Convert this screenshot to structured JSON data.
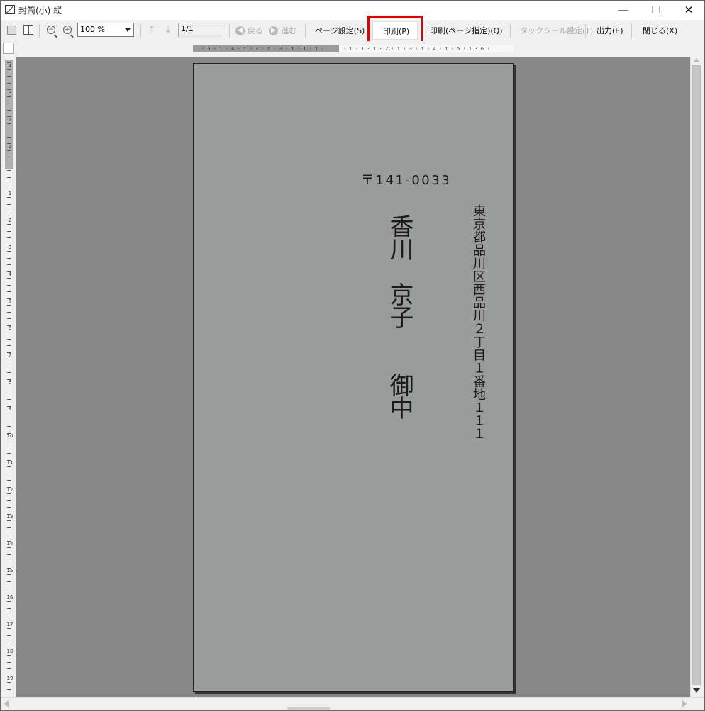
{
  "window": {
    "title": "封筒(小) 縦",
    "minimize": "—",
    "maximize": "☐",
    "close": "✕"
  },
  "toolbar": {
    "zoom_value": "100 %",
    "page_value": "1/1",
    "back_label": "戻る",
    "forward_label": "進む",
    "page_setup_label": "ページ設定(S)",
    "print_label": "印刷(P)",
    "print_pages_label": "印刷(ページ指定)(Q)",
    "tack_seal_label": "タックシール設定(T)",
    "output_label": "出力(E)",
    "close_label": "閉じる(X)"
  },
  "ruler": {
    "h_left": "· 5 · ı · 4 · ı · 3 · ı · 2 · ı · 1 · ı ·",
    "h_right": "· ı · 1 · ı · 2 · ı · 3 · ı · 4 · ı · 5 · ı · 6 ·",
    "v_dark_labels": [
      "4",
      "3",
      "2",
      "1"
    ],
    "v_labels": [
      "1",
      "2",
      "3",
      "4",
      "5",
      "6",
      "7",
      "8",
      "9",
      "10",
      "11",
      "12",
      "13",
      "14",
      "15",
      "16",
      "17",
      "18",
      "19"
    ]
  },
  "envelope": {
    "postal_code": "〒141-0033",
    "address": "東京都品川区西品川２丁目１番地１１１",
    "recipient_name": "香川　京子",
    "honorific": "御中"
  },
  "colors": {
    "highlight": "#e00000",
    "page_bg": "#9a9c9b",
    "canvas_bg": "#878787"
  }
}
